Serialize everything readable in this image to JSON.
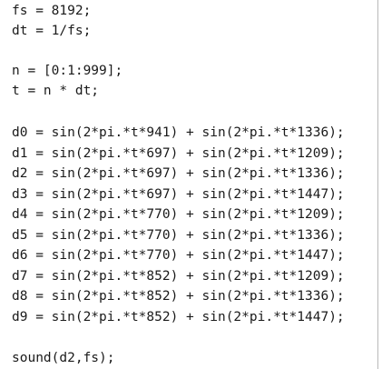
{
  "editor": {
    "lines": [
      "fs = 8192;",
      "dt = 1/fs;",
      "",
      "n = [0:1:999];",
      "t = n * dt;",
      "",
      "d0 = sin(2*pi.*t*941) + sin(2*pi.*t*1336);",
      "d1 = sin(2*pi.*t*697) + sin(2*pi.*t*1209);",
      "d2 = sin(2*pi.*t*697) + sin(2*pi.*t*1336);",
      "d3 = sin(2*pi.*t*697) + sin(2*pi.*t*1447);",
      "d4 = sin(2*pi.*t*770) + sin(2*pi.*t*1209);",
      "d5 = sin(2*pi.*t*770) + sin(2*pi.*t*1336);",
      "d6 = sin(2*pi.*t*770) + sin(2*pi.*t*1447);",
      "d7 = sin(2*pi.*t*852) + sin(2*pi.*t*1209);",
      "d8 = sin(2*pi.*t*852) + sin(2*pi.*t*1336);",
      "d9 = sin(2*pi.*t*852) + sin(2*pi.*t*1447);",
      "",
      "sound(d2,fs);"
    ]
  }
}
